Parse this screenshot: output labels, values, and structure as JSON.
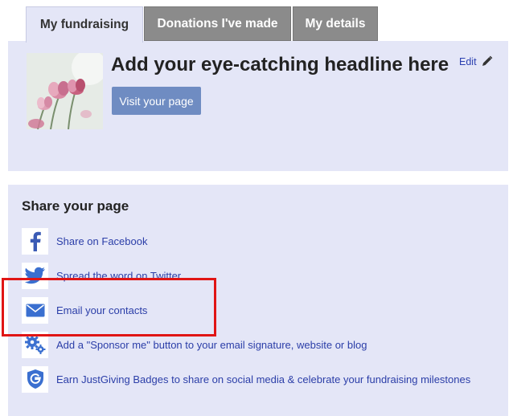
{
  "tabs": [
    {
      "label": "My fundraising",
      "active": true
    },
    {
      "label": "Donations I've made",
      "active": false
    },
    {
      "label": "My details",
      "active": false
    }
  ],
  "profile": {
    "headline": "Add your eye-catching headline here",
    "edit_label": "Edit",
    "visit_button": "Visit your page"
  },
  "share": {
    "title": "Share your page",
    "items": [
      {
        "label": "Share on Facebook",
        "icon": "facebook-icon"
      },
      {
        "label": "Spread the word on Twitter",
        "icon": "twitter-icon"
      },
      {
        "label": "Email your contacts",
        "icon": "email-icon"
      },
      {
        "label": "Add a \"Sponsor me\" button to your email signature, website or blog",
        "icon": "gears-icon"
      },
      {
        "label": "Earn JustGiving Badges to share on social media & celebrate your fundraising milestones",
        "icon": "badge-icon"
      }
    ]
  },
  "colors": {
    "panel_bg": "#e4e6f7",
    "link": "#2b3ea8",
    "button": "#6f8cc2",
    "inactive_tab": "#8b8b8b",
    "highlight": "#e01515"
  }
}
